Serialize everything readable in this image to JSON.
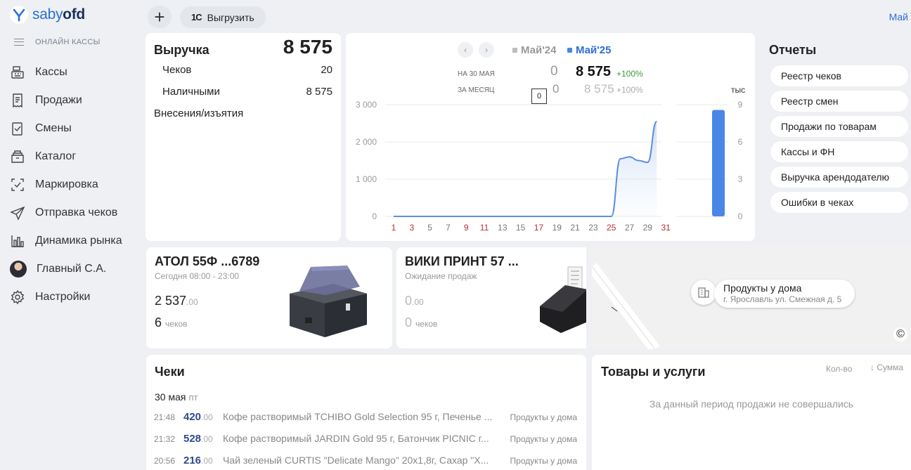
{
  "logo": {
    "text_a": "sabу",
    "text_b": "ofd"
  },
  "sidebar": {
    "section": "ОНЛАЙН КАССЫ",
    "items": [
      {
        "label": "Кассы",
        "icon": "cash-register-icon"
      },
      {
        "label": "Продажи",
        "icon": "receipt-icon"
      },
      {
        "label": "Смены",
        "icon": "shift-icon"
      },
      {
        "label": "Каталог",
        "icon": "catalog-icon"
      },
      {
        "label": "Маркировка",
        "icon": "marking-icon"
      },
      {
        "label": "Отправка чеков",
        "icon": "send-icon"
      },
      {
        "label": "Динамика рынка",
        "icon": "bar-chart-icon"
      },
      {
        "label": "Главный С.А.",
        "icon": "avatar"
      },
      {
        "label": "Настройки",
        "icon": "gear-icon"
      }
    ]
  },
  "toolbar": {
    "export_label": "Выгрузить",
    "onec": "1С",
    "period": "Май"
  },
  "revenue": {
    "title": "Выручка",
    "total": "8 575",
    "rows": [
      {
        "label": "Чеков",
        "value": "20"
      },
      {
        "label": "Наличными",
        "value": "8 575"
      }
    ],
    "deposits": "Внесения/изъятия"
  },
  "chart_head": {
    "legend_prev": "Май'24",
    "legend_cur": "Май'25",
    "date_label": "НА 30 МАЯ",
    "month_label": "ЗА МЕСЯЦ",
    "prev_day": "0",
    "cur_day": "8 575",
    "cur_day_pct": "+100%",
    "prev_month": "0",
    "cur_month": "8 575",
    "cur_month_pct": "+100%",
    "tooltip": "0",
    "unit": "тыс"
  },
  "chart_data": {
    "type": "area",
    "x": [
      1,
      2,
      3,
      4,
      5,
      6,
      7,
      8,
      9,
      10,
      11,
      12,
      13,
      14,
      15,
      16,
      17,
      18,
      19,
      20,
      21,
      22,
      23,
      24,
      25,
      26,
      27,
      28,
      29,
      30,
      31
    ],
    "x_tick_labels": [
      "1",
      "3",
      "5",
      "7",
      "9",
      "11",
      "13",
      "15",
      "17",
      "19",
      "21",
      "23",
      "25",
      "27",
      "29",
      "31"
    ],
    "highlight_ticks": [
      "1",
      "3",
      "9",
      "11",
      "17",
      "25",
      "31"
    ],
    "y_ticks": [
      "0",
      "1 000",
      "2 000",
      "3 000"
    ],
    "ylim": [
      0,
      3000
    ],
    "series": [
      {
        "values": [
          0,
          0,
          0,
          0,
          0,
          0,
          0,
          0,
          0,
          0,
          0,
          0,
          0,
          0,
          0,
          0,
          0,
          0,
          0,
          0,
          0,
          0,
          0,
          0,
          0,
          1550,
          1600,
          1500,
          1450,
          2550,
          null
        ],
        "color": "#5b8fde"
      }
    ],
    "bar": {
      "value": 8.575,
      "ylim": [
        0,
        9
      ],
      "y_ticks": [
        "0",
        "3",
        "6",
        "9"
      ],
      "color": "#4a86e8"
    }
  },
  "reports": {
    "title": "Отчеты",
    "items": [
      "Реестр чеков",
      "Реестр смен",
      "Продажи по товарам",
      "Кассы и ФН",
      "Выручка арендодателю",
      "Ошибки в чеках"
    ]
  },
  "kassa1": {
    "title": "АТОЛ 55Ф ...6789",
    "sub": "Сегодня 08:00 - 23:00",
    "sum": "2 537",
    "sum_cents": ".00",
    "count": "6",
    "count_label": "чеков"
  },
  "kassa2": {
    "title": "ВИКИ ПРИНТ 57 ...",
    "sub": "Ожидание продаж",
    "sum": "0",
    "sum_cents": ".00",
    "count": "0",
    "count_label": "чеков"
  },
  "map": {
    "shop_name": "Продукты у дома",
    "shop_addr": "г. Ярославль ул. Смежная д. 5",
    "copyright": "©"
  },
  "checks": {
    "title": "Чеки",
    "date": "30 мая",
    "weekday": "пт",
    "rows": [
      {
        "time": "21:48",
        "sum": "420",
        "cents": ".00",
        "desc": "Кофе растворимый TCHIBO Gold Selection 95 г, Печенье ...",
        "shop": "Продукты у дома"
      },
      {
        "time": "21:32",
        "sum": "528",
        "cents": ".00",
        "desc": "Кофе растворимый JARDIN Gold 95 г, Батончик PICNIC г...",
        "shop": "Продукты у дома"
      },
      {
        "time": "20:56",
        "sum": "216",
        "cents": ".00",
        "desc": "Чай зеленый CURTIS \"Delicate Mango\" 20x1,8г, Сахар \"Х...",
        "shop": "Продукты у дома"
      }
    ]
  },
  "goods": {
    "title": "Товары и услуги",
    "col_qty": "Кол-во",
    "col_sum": "↓ Сумма",
    "empty": "За данный период продажи не совершались"
  }
}
